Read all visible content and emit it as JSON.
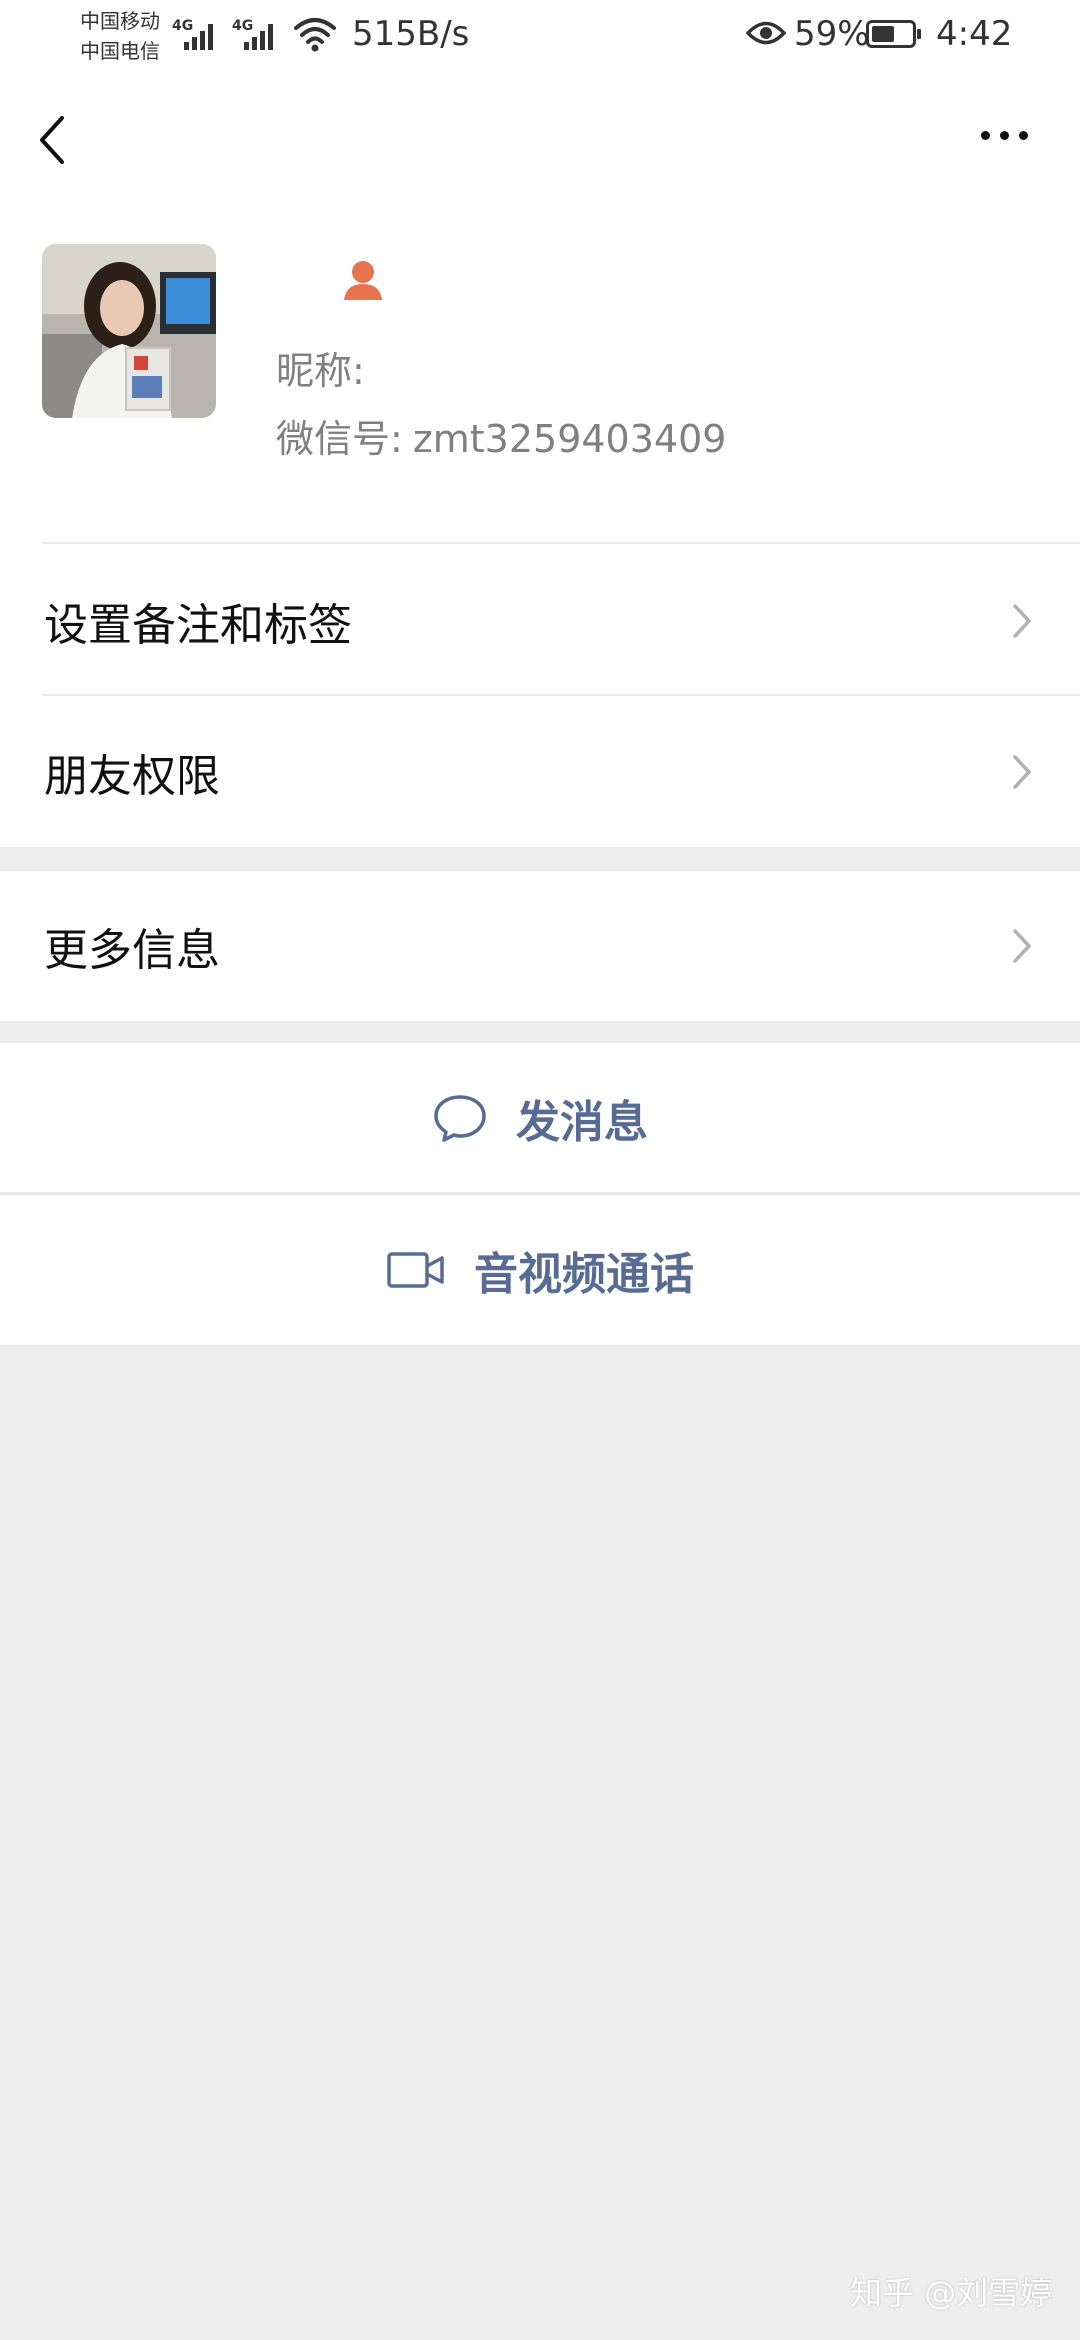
{
  "status_bar": {
    "carrier_1": "中国移动",
    "carrier_2": "中国电信",
    "network_1": "4G",
    "network_2": "4G",
    "net_speed": "515B/s",
    "battery_percent": "59%",
    "battery_level": 0.59,
    "time": "4:42"
  },
  "nav": {
    "back_icon": "chevron-left-icon",
    "more_icon": "more-dots-icon"
  },
  "profile": {
    "gender_icon": "female-icon",
    "gender_color": "#e8734f",
    "nickname_label": "昵称:",
    "wechat_id_label": "微信号:",
    "wechat_id": "zmt3259403409"
  },
  "menu": {
    "remark_tags": "设置备注和标签",
    "friend_permissions": "朋友权限",
    "more_info": "更多信息"
  },
  "actions": {
    "send_message": "发消息",
    "send_message_icon": "chat-bubble-icon",
    "video_call": "音视频通话",
    "video_call_icon": "video-camera-icon",
    "accent_color": "#576b95"
  },
  "watermark": "知乎 @刘雪婷"
}
